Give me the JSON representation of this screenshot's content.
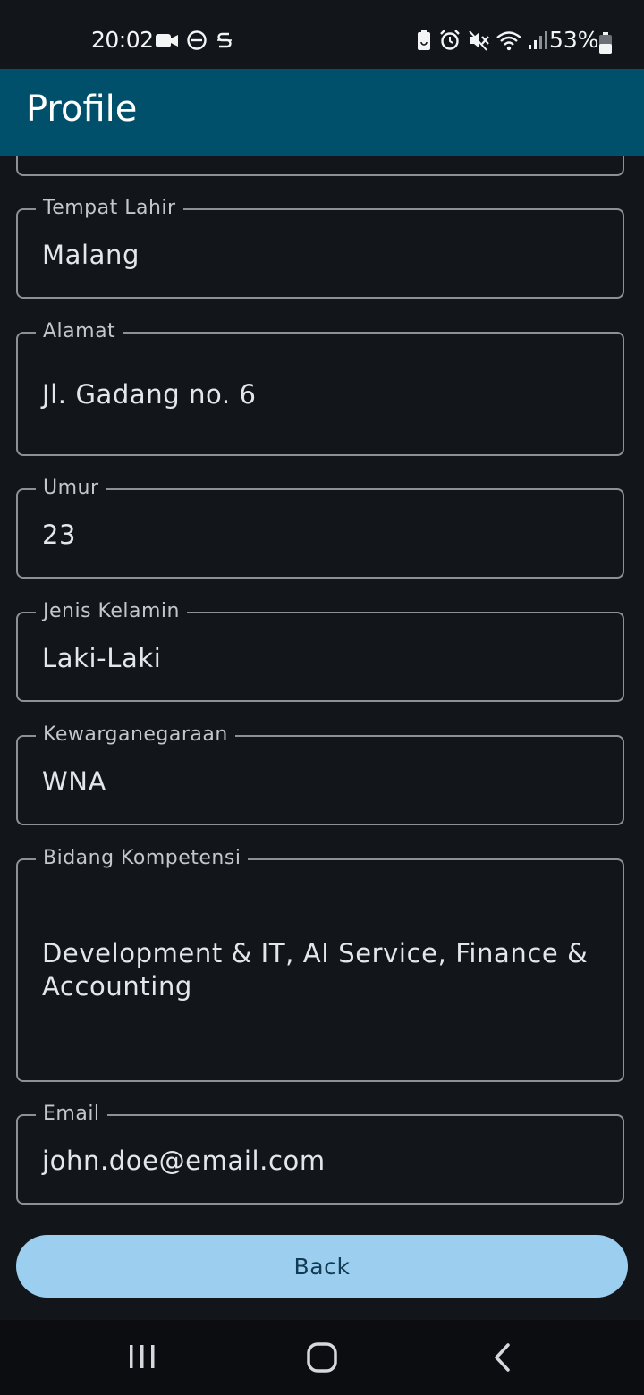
{
  "status_bar": {
    "time": "20:02",
    "battery_text": "53%",
    "left_icons": [
      "video-camera-icon",
      "do-not-disturb-icon",
      "s-app-icon"
    ],
    "right_icons": [
      "battery-saver-icon",
      "alarm-icon",
      "vibrate-mute-icon",
      "wifi-icon",
      "signal-icon",
      "battery-icon"
    ]
  },
  "app_bar": {
    "title": "Profile"
  },
  "fields": [
    {
      "label": "",
      "value": ""
    },
    {
      "label": "Tempat Lahir",
      "value": "Malang"
    },
    {
      "label": "Alamat",
      "value": "Jl. Gadang no. 6"
    },
    {
      "label": "Umur",
      "value": "23"
    },
    {
      "label": "Jenis Kelamin",
      "value": "Laki-Laki"
    },
    {
      "label": "Kewarganegaraan",
      "value": "WNA"
    },
    {
      "label": "Bidang Kompetensi",
      "value": "Development & IT, AI Service, Finance & Accounting"
    },
    {
      "label": "Email",
      "value": "john.doe@email.com"
    }
  ],
  "back_button": {
    "label": "Back"
  },
  "nav_bar": {
    "buttons": [
      "recent-apps-icon",
      "home-icon",
      "back-icon"
    ]
  },
  "colors": {
    "app_bar": "#00506b",
    "background": "#121519",
    "button": "#9ccfef"
  }
}
